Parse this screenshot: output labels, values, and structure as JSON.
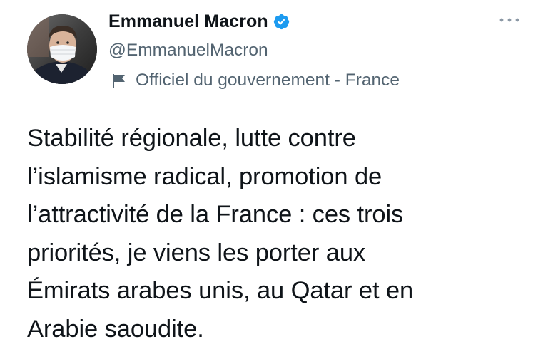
{
  "author": {
    "display_name": "Emmanuel Macron",
    "handle": "@EmmanuelMacron",
    "label": "Officiel du gouvernement - France",
    "verified_icon": "verified-badge-icon",
    "label_icon": "flag-icon",
    "avatar_icon": "profile-photo"
  },
  "menu": {
    "icon": "more-options-icon"
  },
  "tweet": {
    "text": "Stabilité régionale, lutte contre\nl’islamisme radical, promotion de\nl’attractivité de la France : ces trois\npriorités, je viens les porter aux\nÉmirats arabes unis, au Qatar et en\nArabie saoudite."
  },
  "colors": {
    "text_primary": "#0f1419",
    "text_secondary": "#536471",
    "verified_blue": "#1d9bf0",
    "background": "#ffffff"
  }
}
